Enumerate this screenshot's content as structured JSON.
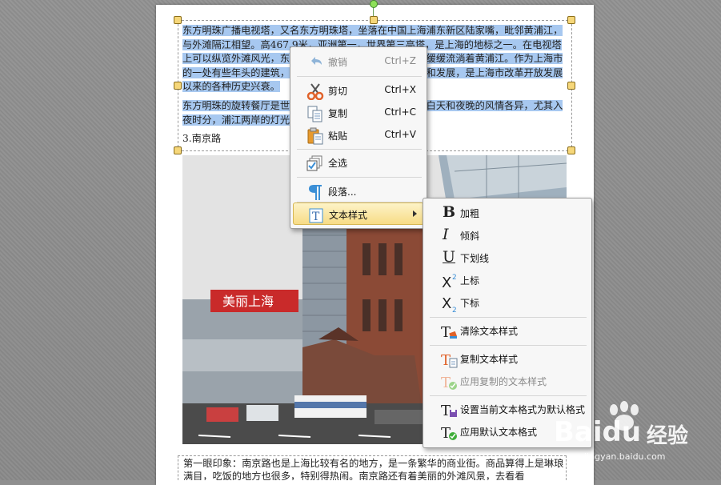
{
  "document": {
    "paragraph1": "东方明珠广播电视塔，又名东方明珠塔，坐落在中国上海浦东新区陆家嘴，毗邻黄浦江，与外滩隔江相望。高467.9米，亚洲第一，世界第三高塔，是上海的地标之一。在电视塔上可以纵览外滩风光，东面是陆家嘴金融贸易区，南面是缓缓流淌着黄浦江。作为上海市的一处有些年头的建筑，东方明珠见证了上海的改革开放和发展，是上海市改革开放发展以来的各种历史兴衰。",
    "paragraph2": "东方明珠的旋转餐厅是世界上最高的旋转餐厅之一，这里白天和夜晚的风情各异，尤其入夜时分，浦江两岸的灯光次第亮起，美不胜收。",
    "heading3": "3.南京路",
    "bottom_text": "第一眼印象：南京路也是上海比较有名的地方，是一条繁华的商业街。商品算得上是琳琅满目，吃饭的地方也很多，特别得热闹。南京路还有着美丽的外滩风景，去看看",
    "sign_text": "美丽上海"
  },
  "context_menu": {
    "items": [
      {
        "label": "撤销",
        "shortcut": "Ctrl+Z",
        "icon": "undo-icon",
        "disabled": true
      },
      {
        "label": "剪切",
        "shortcut": "Ctrl+X",
        "icon": "scissors-icon"
      },
      {
        "label": "复制",
        "shortcut": "Ctrl+C",
        "icon": "copy-icon"
      },
      {
        "label": "粘贴",
        "shortcut": "Ctrl+V",
        "icon": "paste-icon"
      },
      {
        "label": "全选",
        "icon": "select-all-icon"
      },
      {
        "label": "段落...",
        "icon": "paragraph-icon"
      },
      {
        "label": "文本样式",
        "icon": "text-style-icon",
        "has_submenu": true
      }
    ]
  },
  "submenu": {
    "items": [
      {
        "label": "加粗",
        "icon": "bold-icon"
      },
      {
        "label": "倾斜",
        "icon": "italic-icon"
      },
      {
        "label": "下划线",
        "icon": "underline-icon"
      },
      {
        "label": "上标",
        "icon": "superscript-icon"
      },
      {
        "label": "下标",
        "icon": "subscript-icon"
      },
      {
        "label": "清除文本样式",
        "icon": "clear-style-icon"
      },
      {
        "label": "复制文本样式",
        "icon": "copy-style-icon"
      },
      {
        "label": "应用复制的文本样式",
        "icon": "apply-copied-style-icon",
        "disabled": true
      },
      {
        "label": "设置当前文本格式为默认格式",
        "icon": "set-default-format-icon"
      },
      {
        "label": "应用默认文本格式",
        "icon": "apply-default-format-icon"
      }
    ]
  },
  "watermark": {
    "brand": "Baidu",
    "brand_cn": "经验",
    "url": "jingyan.baidu.com"
  },
  "colors": {
    "selection": "#a7c8f0",
    "menu_hover": "#f7dc86",
    "accent_blue": "#3b8fd6",
    "accent_orange": "#e0622a"
  }
}
